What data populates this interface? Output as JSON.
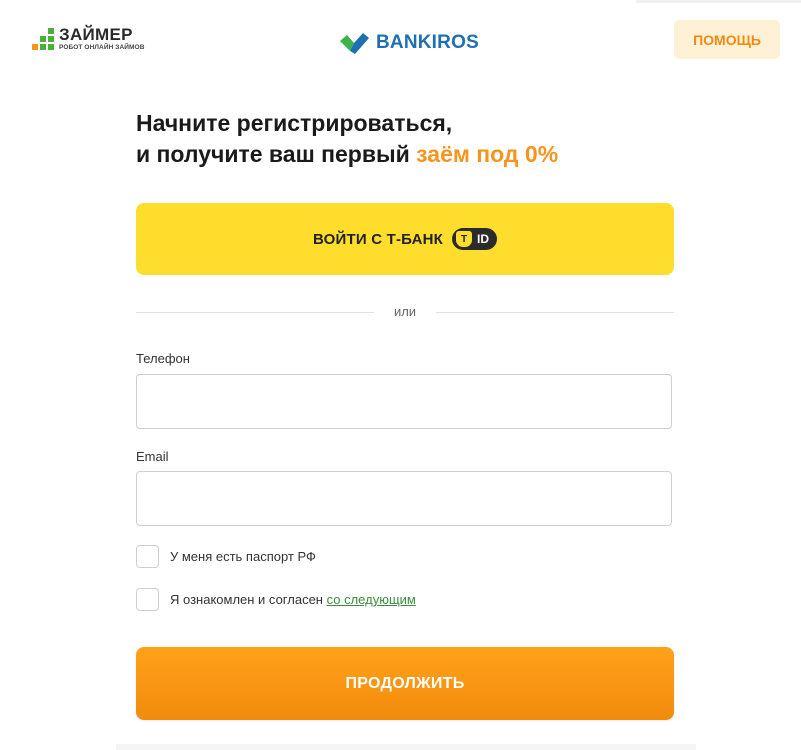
{
  "header": {
    "zaimer_name": "ЗАЙМЕР",
    "zaimer_tagline": "РОБОТ ОНЛАЙН ЗАЙМОВ",
    "bankiros_name": "BANKIROS",
    "help_label": "ПОМОЩЬ"
  },
  "heading": {
    "line1": "Начните регистрироваться,",
    "line2_prefix": "и получите ваш первый ",
    "line2_accent": "заём под 0%"
  },
  "tbank": {
    "label": "ВОЙТИ С Т-БАНК",
    "badge_letter": "Т",
    "badge_text": "ID"
  },
  "divider": {
    "text": "или"
  },
  "form": {
    "phone_label": "Телефон",
    "phone_value": "",
    "email_label": "Email",
    "email_value": ""
  },
  "checkboxes": {
    "passport_label": "У меня есть паспорт РФ",
    "agree_label": "Я ознакомлен и согласен ",
    "agree_link": "со следующим"
  },
  "continue_label": "ПРОДОЛЖИТЬ",
  "colors": {
    "accent_orange": "#f7941d",
    "tbank_yellow": "#ffdd2d",
    "brand_blue": "#1f6fb3",
    "zaimer_green": "#4caf3a",
    "link_green": "#3a8d3a"
  },
  "icons": {
    "zaimer_logo": "zaimer-squares-logo",
    "bankiros_logo": "bankiros-check-logo",
    "tid_badge": "t-id-shield-icon"
  }
}
